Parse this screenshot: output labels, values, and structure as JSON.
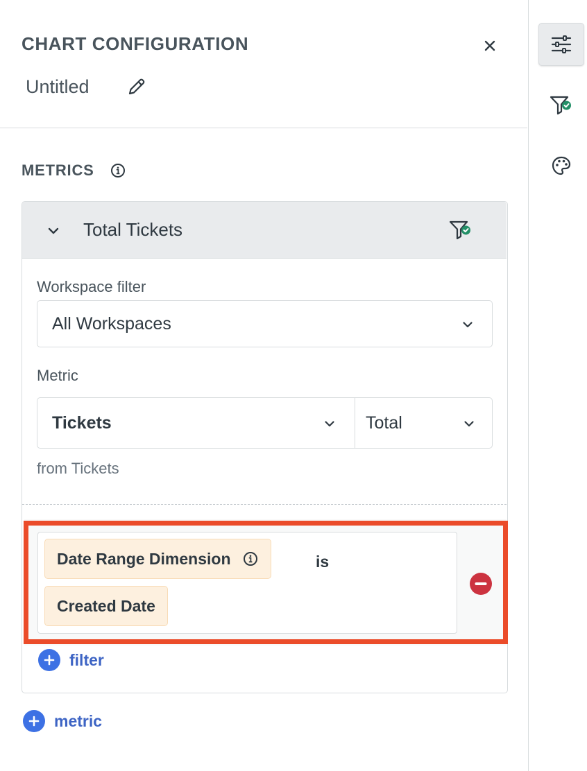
{
  "header": {
    "title": "CHART CONFIGURATION",
    "chart_name": "Untitled"
  },
  "metrics_section": {
    "label": "METRICS"
  },
  "metric": {
    "name": "Total Tickets",
    "workspace_filter_label": "Workspace filter",
    "workspace_filter_value": "All Workspaces",
    "metric_label": "Metric",
    "metric_value": "Tickets",
    "aggregation_value": "Total",
    "source_hint": "from Tickets",
    "filter": {
      "dimension": "Date Range Dimension",
      "operator": "is",
      "value": "Created Date"
    },
    "add_filter_label": "filter"
  },
  "add_metric_label": "metric",
  "rail": {
    "items": [
      "sliders-icon",
      "filter-check-icon",
      "palette-icon"
    ],
    "active": "sliders-icon"
  },
  "colors": {
    "highlight": "#eb4c2a",
    "accent": "#3d71e4",
    "remove": "#cc3340",
    "chip": "#fdf0df",
    "check": "#228f67"
  }
}
